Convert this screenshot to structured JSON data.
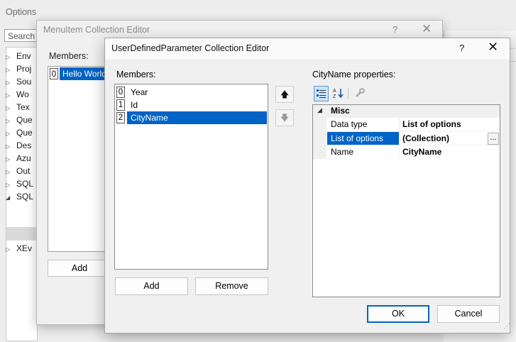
{
  "options": {
    "title": "Options",
    "search_placeholder": "Search (",
    "tree_items": [
      {
        "label": "Env",
        "expanded": false
      },
      {
        "label": "Proj",
        "expanded": false
      },
      {
        "label": "Sou",
        "expanded": false
      },
      {
        "label": "Wo",
        "expanded": false
      },
      {
        "label": "Tex",
        "expanded": false
      },
      {
        "label": "Que",
        "expanded": false
      },
      {
        "label": "Que",
        "expanded": false
      },
      {
        "label": "Des",
        "expanded": false
      },
      {
        "label": "Azu",
        "expanded": false
      },
      {
        "label": "Out",
        "expanded": false
      },
      {
        "label": "SQL",
        "expanded": false
      },
      {
        "label": "SQL",
        "expanded": true
      },
      {
        "label": "XEv",
        "expanded": false
      }
    ]
  },
  "menu_editor": {
    "title": "MenuItem Collection Editor",
    "help": "?",
    "close": "✕",
    "members_label": "Members:",
    "members": [
      {
        "index": "0",
        "label": "Hello World"
      }
    ],
    "add_label": "Add"
  },
  "param_editor": {
    "title": "UserDefinedParameter Collection Editor",
    "help": "?",
    "close": "✕",
    "members_label": "Members:",
    "members": [
      {
        "index": "0",
        "label": "Year"
      },
      {
        "index": "1",
        "label": "Id"
      },
      {
        "index": "2",
        "label": "CityName"
      }
    ],
    "selected_index": 2,
    "move_up_icon": "arrow-up-icon",
    "move_down_icon": "arrow-down-icon",
    "add_label": "Add",
    "remove_label": "Remove",
    "properties_label": "CityName properties:",
    "toolbar": [
      "categorized-icon",
      "alphabetical-icon",
      "property-pages-icon"
    ],
    "category": "Misc",
    "properties": [
      {
        "name": "Data type",
        "value": "List of options"
      },
      {
        "name": "List of options",
        "value": "(Collection)"
      },
      {
        "name": "Name",
        "value": "CityName"
      }
    ],
    "selected_property": 1,
    "ellipsis_label": "...",
    "ok_label": "OK",
    "cancel_label": "Cancel",
    "accent_color": "#0063c5"
  }
}
